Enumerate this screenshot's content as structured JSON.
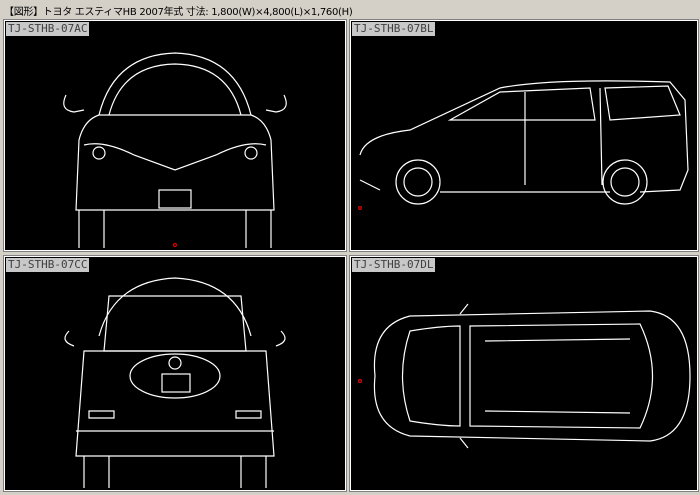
{
  "header": {
    "title": "【図形】トヨタ エスティマHB 2007年式  寸法: 1,800(W)×4,800(L)×1,760(H)"
  },
  "panels": [
    {
      "label": "TJ-STHB-07AC",
      "view": "front"
    },
    {
      "label": "TJ-STHB-07BL",
      "view": "side"
    },
    {
      "label": "TJ-STHB-07CC",
      "view": "rear"
    },
    {
      "label": "TJ-STHB-07DL",
      "view": "top"
    }
  ]
}
